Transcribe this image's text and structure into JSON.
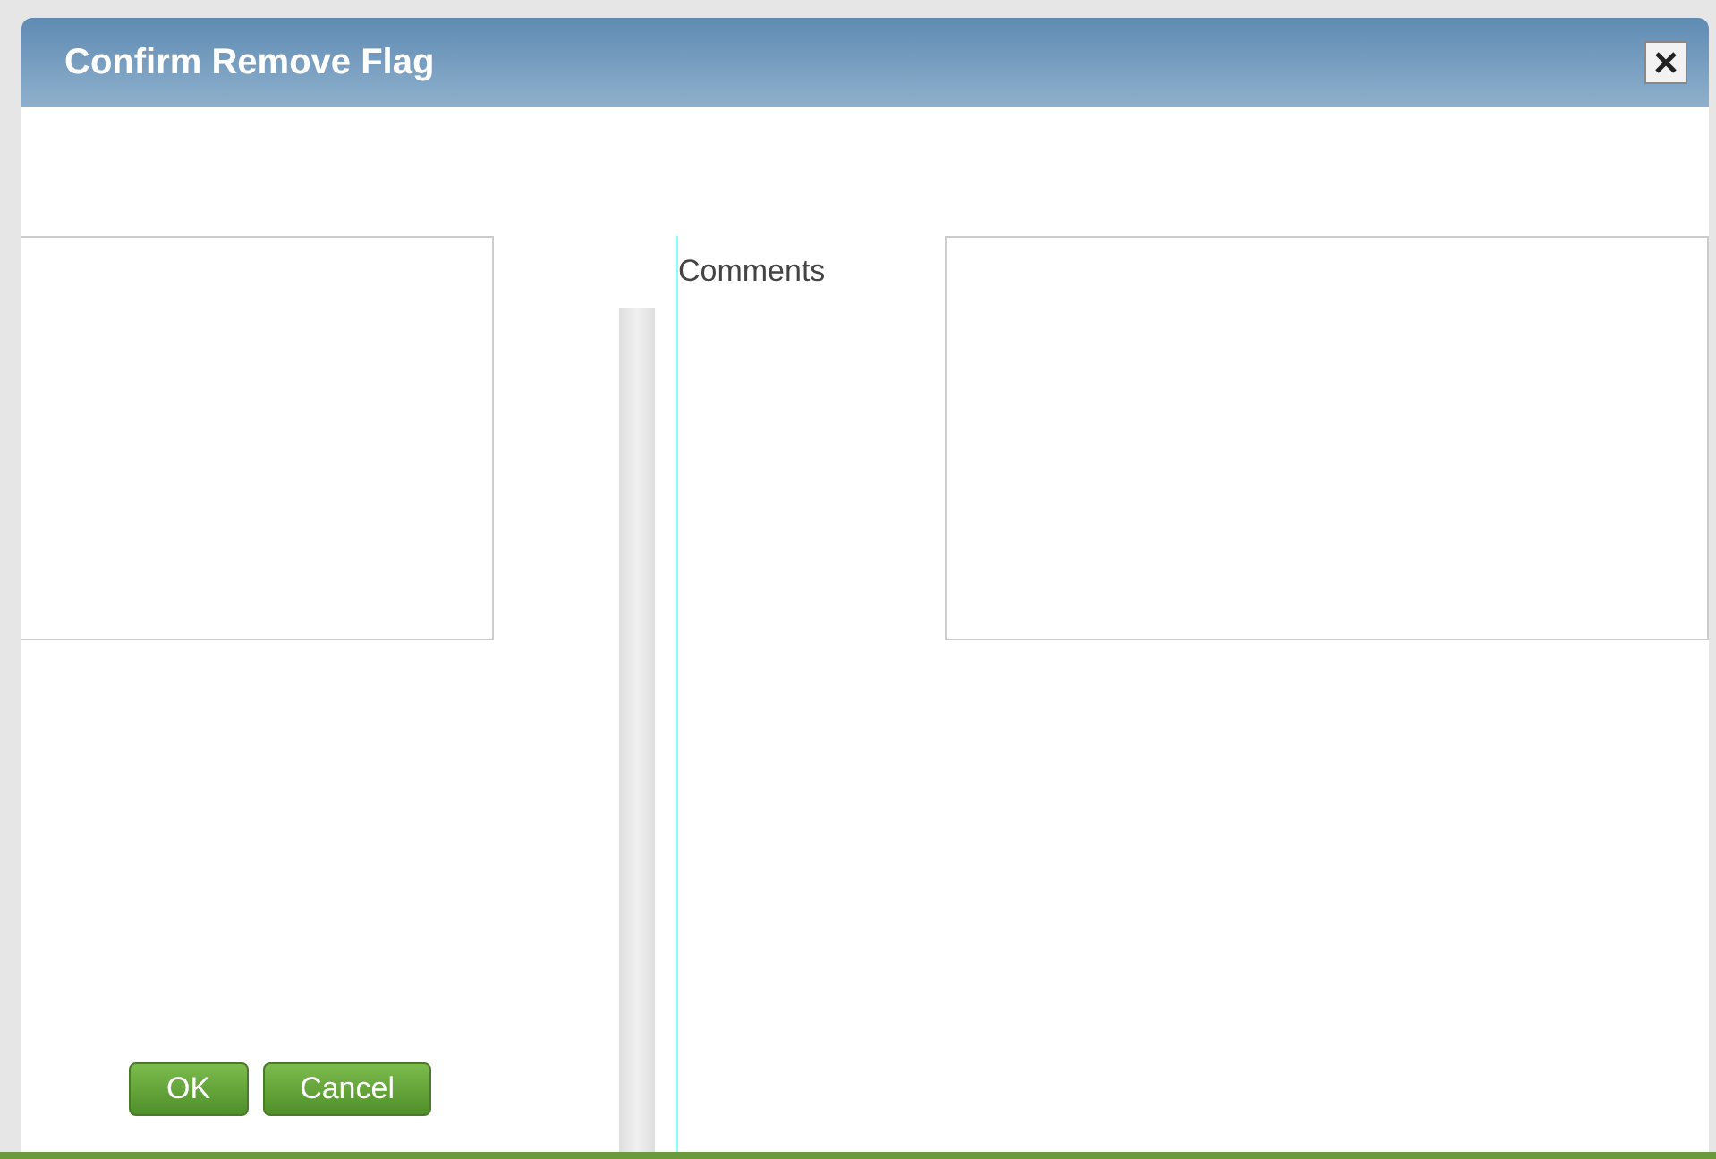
{
  "dialog": {
    "title": "Confirm Remove Flag"
  },
  "comments": {
    "label": "Comments"
  },
  "buttons": [
    {
      "label": "OK",
      "kind": "primary"
    },
    {
      "label": "Cancel",
      "kind": "primary"
    }
  ]
}
